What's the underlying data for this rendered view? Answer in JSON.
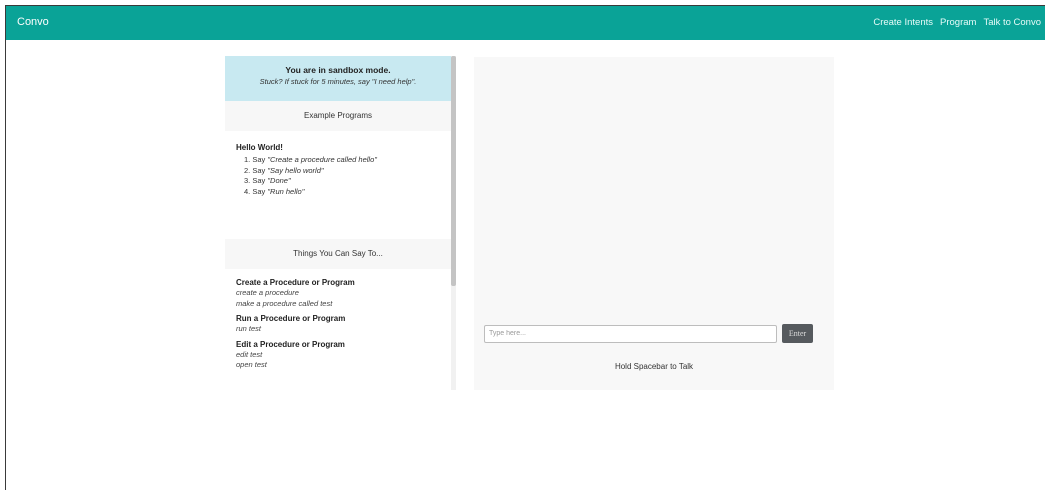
{
  "navbar": {
    "brand": "Convo",
    "links": [
      "Create Intents",
      "Program",
      "Talk to Convo"
    ]
  },
  "sandbox": {
    "title": "You are in sandbox mode.",
    "subtitle": "Stuck? If stuck for 5 minutes, say \"I need help\"."
  },
  "examples": {
    "header": "Example Programs",
    "program_title": "Hello World!",
    "steps": [
      {
        "num": "1. Say ",
        "text": "\"Create a procedure called hello\""
      },
      {
        "num": "2. Say ",
        "text": "\"Say hello world\""
      },
      {
        "num": "3. Say ",
        "text": "\"Done\""
      },
      {
        "num": "4. Say ",
        "text": "\"Run hello\""
      }
    ]
  },
  "things": {
    "header": "Things You Can Say To...",
    "groups": [
      {
        "title": "Create a Procedure or Program",
        "examples": [
          "create a procedure",
          "make a procedure called test"
        ]
      },
      {
        "title": "Run a Procedure or Program",
        "examples": [
          "run test"
        ]
      },
      {
        "title": "Edit a Procedure or Program",
        "examples": [
          "edit test",
          "open test"
        ]
      }
    ]
  },
  "chat": {
    "input_placeholder": "Type here...",
    "input_value": "",
    "enter_label": "Enter",
    "hold_text": "Hold Spacebar to Talk"
  },
  "colors": {
    "navbar": "#0aa397",
    "sandbox_bg": "#c8e9f1",
    "enter_button": "#565a5e"
  }
}
